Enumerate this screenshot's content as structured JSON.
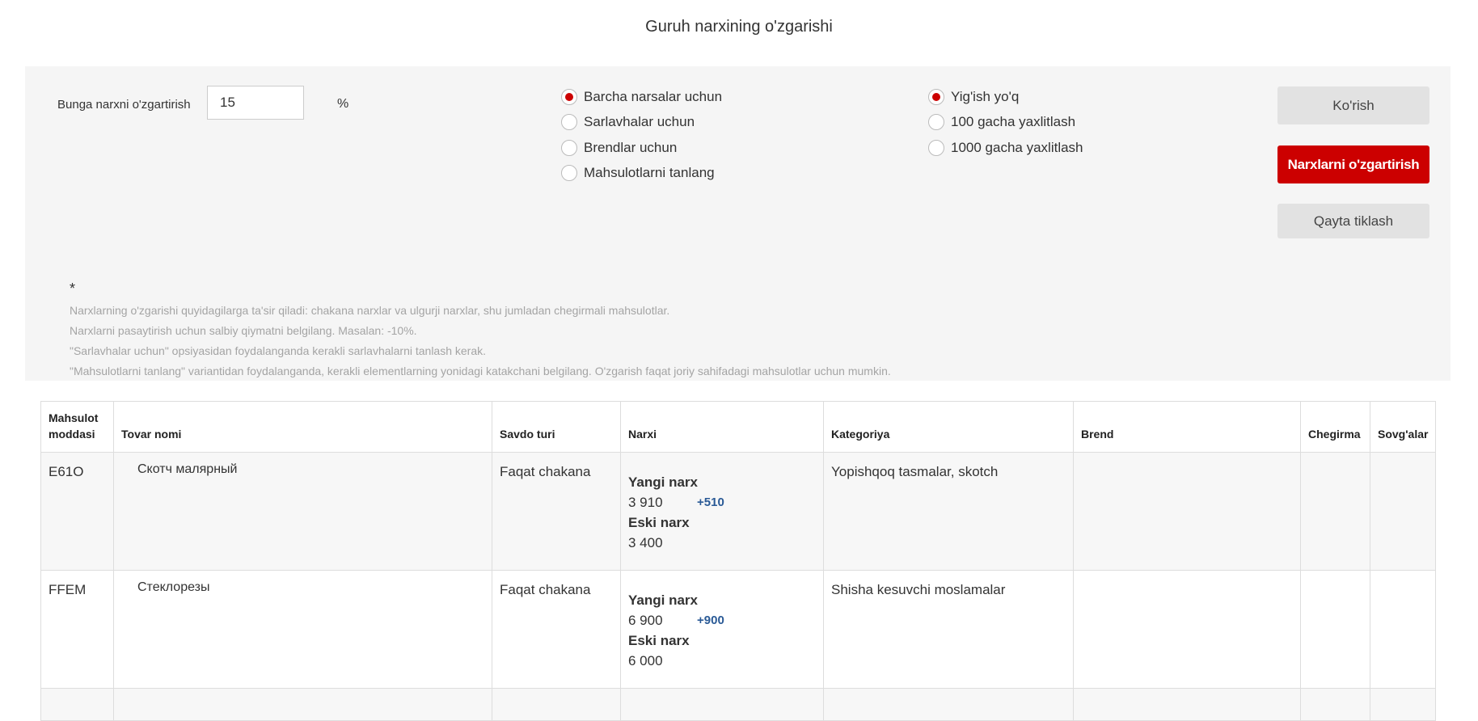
{
  "title": "Guruh narxining o'zgarishi",
  "percent": {
    "label": "Bunga narxni o'zgartirish",
    "value": "15",
    "unit": "%"
  },
  "scope_options": [
    {
      "label": "Barcha narsalar uchun",
      "selected": true
    },
    {
      "label": "Sarlavhalar uchun",
      "selected": false
    },
    {
      "label": "Brendlar uchun",
      "selected": false
    },
    {
      "label": "Mahsulotlarni tanlang",
      "selected": false
    }
  ],
  "rounding_options": [
    {
      "label": "Yig'ish yo'q",
      "selected": true
    },
    {
      "label": "100 gacha yaxlitlash",
      "selected": false
    },
    {
      "label": "1000 gacha yaxlitlash",
      "selected": false
    }
  ],
  "buttons": {
    "preview": "Ko'rish",
    "apply": "Narxlarni o'zgartirish",
    "reset": "Qayta tiklash"
  },
  "notes": {
    "marker": "*",
    "lines": [
      "Narxlarning o'zgarishi quyidagilarga ta'sir qiladi: chakana narxlar va ulgurji narxlar, shu jumladan chegirmali mahsulotlar.",
      "Narxlarni pasaytirish uchun salbiy qiymatni belgilang. Masalan: -10%.",
      "\"Sarlavhalar uchun\" opsiyasidan foydalanganda kerakli sarlavhalarni tanlash kerak.",
      "\"Mahsulotlarni tanlang\" variantidan foydalanganda, kerakli elementlarning yonidagi katakchani belgilang. O'zgarish faqat joriy sahifadagi mahsulotlar uchun mumkin."
    ]
  },
  "table": {
    "headers": {
      "sku": "Mahsulot moddasi",
      "name": "Tovar nomi",
      "trade_type": "Savdo turi",
      "price": "Narxi",
      "category": "Kategoriya",
      "brand": "Brend",
      "discount": "Chegirma",
      "gifts": "Sovg'alar"
    },
    "price_labels": {
      "new": "Yangi narx",
      "old": "Eski narx"
    },
    "rows": [
      {
        "sku": "E61O",
        "name": "Скотч малярный",
        "trade_type": "Faqat chakana",
        "new_price": "3 910",
        "diff": "+510",
        "old_price": "3 400",
        "category": "Yopishqoq tasmalar, skotch",
        "brand": "",
        "discount": "",
        "gifts": ""
      },
      {
        "sku": "FFEM",
        "name": "Стеклорезы",
        "trade_type": "Faqat chakana",
        "new_price": "6 900",
        "diff": "+900",
        "old_price": "6 000",
        "category": "Shisha kesuvchi moslamalar",
        "brand": "",
        "discount": "",
        "gifts": ""
      }
    ]
  },
  "colors": {
    "accent": "#cc0000",
    "price_diff": "#2a5a96",
    "panel_bg": "#f5f5f5"
  }
}
